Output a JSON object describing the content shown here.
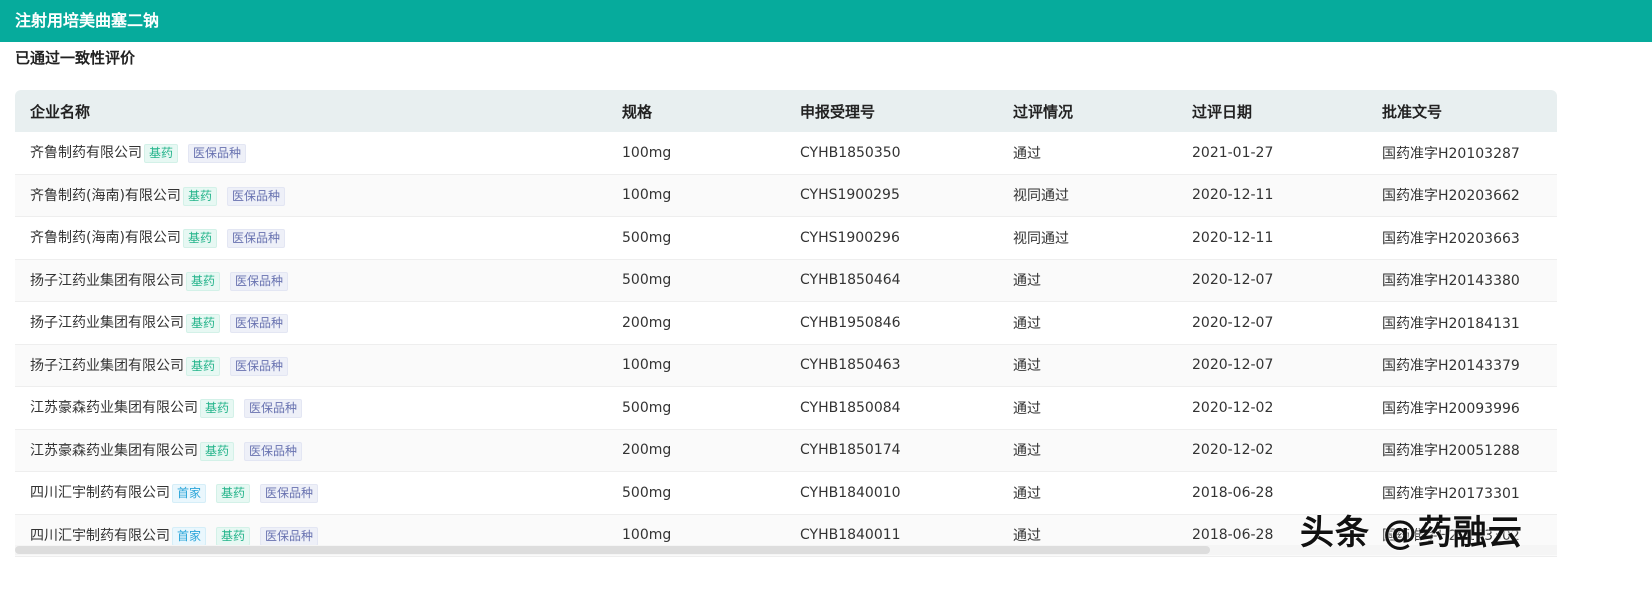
{
  "header": {
    "title": "注射用培美曲塞二钠"
  },
  "section": {
    "title": "已通过一致性评价"
  },
  "table": {
    "columns": [
      "企业名称",
      "规格",
      "申报受理号",
      "过评情况",
      "过评日期",
      "批准文号"
    ],
    "rows": [
      {
        "company": "齐鲁制药有限公司",
        "tags": [
          "基药",
          "医保品种"
        ],
        "spec": "100mg",
        "acceptance": "CYHB1850350",
        "status": "通过",
        "date": "2021-01-27",
        "approval": "国药准字H20103287"
      },
      {
        "company": "齐鲁制药(海南)有限公司",
        "tags": [
          "基药",
          "医保品种"
        ],
        "spec": "100mg",
        "acceptance": "CYHS1900295",
        "status": "视同通过",
        "date": "2020-12-11",
        "approval": "国药准字H20203662"
      },
      {
        "company": "齐鲁制药(海南)有限公司",
        "tags": [
          "基药",
          "医保品种"
        ],
        "spec": "500mg",
        "acceptance": "CYHS1900296",
        "status": "视同通过",
        "date": "2020-12-11",
        "approval": "国药准字H20203663"
      },
      {
        "company": "扬子江药业集团有限公司",
        "tags": [
          "基药",
          "医保品种"
        ],
        "spec": "500mg",
        "acceptance": "CYHB1850464",
        "status": "通过",
        "date": "2020-12-07",
        "approval": "国药准字H20143380"
      },
      {
        "company": "扬子江药业集团有限公司",
        "tags": [
          "基药",
          "医保品种"
        ],
        "spec": "200mg",
        "acceptance": "CYHB1950846",
        "status": "通过",
        "date": "2020-12-07",
        "approval": "国药准字H20184131"
      },
      {
        "company": "扬子江药业集团有限公司",
        "tags": [
          "基药",
          "医保品种"
        ],
        "spec": "100mg",
        "acceptance": "CYHB1850463",
        "status": "通过",
        "date": "2020-12-07",
        "approval": "国药准字H20143379"
      },
      {
        "company": "江苏豪森药业集团有限公司",
        "tags": [
          "基药",
          "医保品种"
        ],
        "spec": "500mg",
        "acceptance": "CYHB1850084",
        "status": "通过",
        "date": "2020-12-02",
        "approval": "国药准字H20093996"
      },
      {
        "company": "江苏豪森药业集团有限公司",
        "tags": [
          "基药",
          "医保品种"
        ],
        "spec": "200mg",
        "acceptance": "CYHB1850174",
        "status": "通过",
        "date": "2020-12-02",
        "approval": "国药准字H20051288"
      },
      {
        "company": "四川汇宇制药有限公司",
        "tags": [
          "首家",
          "基药",
          "医保品种"
        ],
        "spec": "500mg",
        "acceptance": "CYHB1840010",
        "status": "通过",
        "date": "2018-06-28",
        "approval": "国药准字H20173301"
      },
      {
        "company": "四川汇宇制药有限公司",
        "tags": [
          "首家",
          "基药",
          "医保品种"
        ],
        "spec": "100mg",
        "acceptance": "CYHB1840011",
        "status": "通过",
        "date": "2018-06-28",
        "approval": "国药准字H20173302"
      }
    ]
  },
  "watermark": "头条 @药融云"
}
